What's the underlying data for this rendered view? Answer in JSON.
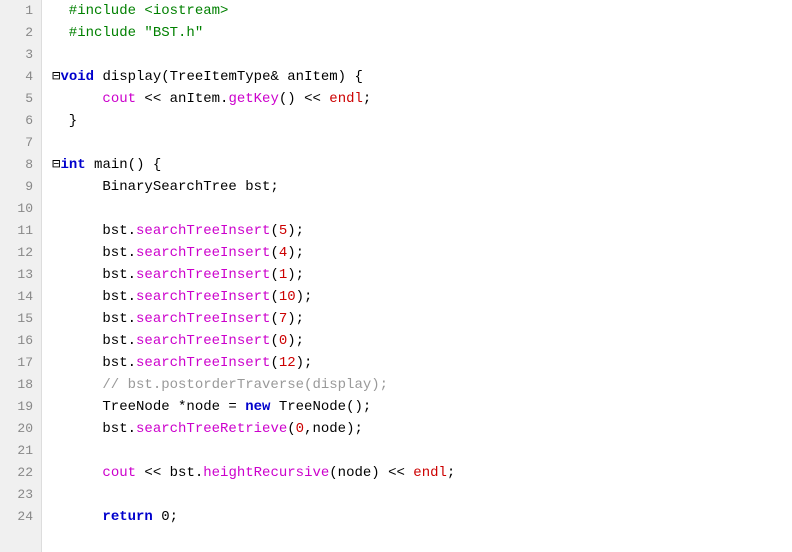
{
  "editor": {
    "lines": [
      {
        "num": 1,
        "tokens": [
          {
            "t": "  #include <iostream>",
            "c": "fn-green"
          }
        ]
      },
      {
        "num": 2,
        "tokens": [
          {
            "t": "  #include \"BST.h\"",
            "c": "fn-green"
          }
        ]
      },
      {
        "num": 3,
        "tokens": []
      },
      {
        "num": 4,
        "tokens": [
          {
            "t": "⊟",
            "c": "plain"
          },
          {
            "t": "void",
            "c": "kw-blue"
          },
          {
            "t": " display(TreeItemType& anItem) {",
            "c": "plain"
          }
        ]
      },
      {
        "num": 5,
        "tokens": [
          {
            "t": "      ",
            "c": "plain"
          },
          {
            "t": "cout",
            "c": "fn-magenta"
          },
          {
            "t": " << anItem.",
            "c": "plain"
          },
          {
            "t": "getKey",
            "c": "fn-magenta"
          },
          {
            "t": "() << ",
            "c": "plain"
          },
          {
            "t": "endl",
            "c": "endl-red"
          },
          {
            "t": ";",
            "c": "plain"
          }
        ]
      },
      {
        "num": 6,
        "tokens": [
          {
            "t": "  }",
            "c": "plain"
          }
        ]
      },
      {
        "num": 7,
        "tokens": []
      },
      {
        "num": 8,
        "tokens": [
          {
            "t": "⊟",
            "c": "plain"
          },
          {
            "t": "int",
            "c": "kw-blue"
          },
          {
            "t": " main() {",
            "c": "plain"
          }
        ]
      },
      {
        "num": 9,
        "tokens": [
          {
            "t": "      BinarySearchTree bst;",
            "c": "plain"
          }
        ]
      },
      {
        "num": 10,
        "tokens": []
      },
      {
        "num": 11,
        "tokens": [
          {
            "t": "      bst.",
            "c": "plain"
          },
          {
            "t": "searchTreeInsert",
            "c": "fn-magenta"
          },
          {
            "t": "(",
            "c": "plain"
          },
          {
            "t": "5",
            "c": "num-red"
          },
          {
            "t": ");",
            "c": "plain"
          }
        ]
      },
      {
        "num": 12,
        "tokens": [
          {
            "t": "      bst.",
            "c": "plain"
          },
          {
            "t": "searchTreeInsert",
            "c": "fn-magenta"
          },
          {
            "t": "(",
            "c": "plain"
          },
          {
            "t": "4",
            "c": "num-red"
          },
          {
            "t": ");",
            "c": "plain"
          }
        ]
      },
      {
        "num": 13,
        "tokens": [
          {
            "t": "      bst.",
            "c": "plain"
          },
          {
            "t": "searchTreeInsert",
            "c": "fn-magenta"
          },
          {
            "t": "(",
            "c": "plain"
          },
          {
            "t": "1",
            "c": "num-red"
          },
          {
            "t": ");",
            "c": "plain"
          }
        ]
      },
      {
        "num": 14,
        "tokens": [
          {
            "t": "      bst.",
            "c": "plain"
          },
          {
            "t": "searchTreeInsert",
            "c": "fn-magenta"
          },
          {
            "t": "(",
            "c": "plain"
          },
          {
            "t": "10",
            "c": "num-red"
          },
          {
            "t": ");",
            "c": "plain"
          }
        ]
      },
      {
        "num": 15,
        "tokens": [
          {
            "t": "      bst.",
            "c": "plain"
          },
          {
            "t": "searchTreeInsert",
            "c": "fn-magenta"
          },
          {
            "t": "(",
            "c": "plain"
          },
          {
            "t": "7",
            "c": "num-red"
          },
          {
            "t": ");",
            "c": "plain"
          }
        ]
      },
      {
        "num": 16,
        "tokens": [
          {
            "t": "      bst.",
            "c": "plain"
          },
          {
            "t": "searchTreeInsert",
            "c": "fn-magenta"
          },
          {
            "t": "(",
            "c": "plain"
          },
          {
            "t": "0",
            "c": "num-red"
          },
          {
            "t": ");",
            "c": "plain"
          }
        ]
      },
      {
        "num": 17,
        "tokens": [
          {
            "t": "      bst.",
            "c": "plain"
          },
          {
            "t": "searchTreeInsert",
            "c": "fn-magenta"
          },
          {
            "t": "(",
            "c": "plain"
          },
          {
            "t": "12",
            "c": "num-red"
          },
          {
            "t": ");",
            "c": "plain"
          }
        ]
      },
      {
        "num": 18,
        "tokens": [
          {
            "t": "      // bst.postorderTraverse(display);",
            "c": "comment"
          }
        ]
      },
      {
        "num": 19,
        "tokens": [
          {
            "t": "      TreeNode *node = ",
            "c": "plain"
          },
          {
            "t": "new",
            "c": "kw-blue"
          },
          {
            "t": " TreeNode();",
            "c": "plain"
          }
        ]
      },
      {
        "num": 20,
        "tokens": [
          {
            "t": "      bst.",
            "c": "plain"
          },
          {
            "t": "searchTreeRetrieve",
            "c": "fn-magenta"
          },
          {
            "t": "(",
            "c": "plain"
          },
          {
            "t": "0",
            "c": "num-red"
          },
          {
            "t": ",node);",
            "c": "plain"
          }
        ]
      },
      {
        "num": 21,
        "tokens": []
      },
      {
        "num": 22,
        "tokens": [
          {
            "t": "      ",
            "c": "plain"
          },
          {
            "t": "cout",
            "c": "fn-magenta"
          },
          {
            "t": " << bst.",
            "c": "plain"
          },
          {
            "t": "heightRecursive",
            "c": "fn-magenta"
          },
          {
            "t": "(node) << ",
            "c": "plain"
          },
          {
            "t": "endl",
            "c": "endl-red"
          },
          {
            "t": ";",
            "c": "plain"
          }
        ]
      },
      {
        "num": 23,
        "tokens": []
      },
      {
        "num": 24,
        "tokens": [
          {
            "t": "      ",
            "c": "plain"
          },
          {
            "t": "return",
            "c": "kw-blue"
          },
          {
            "t": " 0;",
            "c": "plain"
          }
        ]
      }
    ]
  }
}
